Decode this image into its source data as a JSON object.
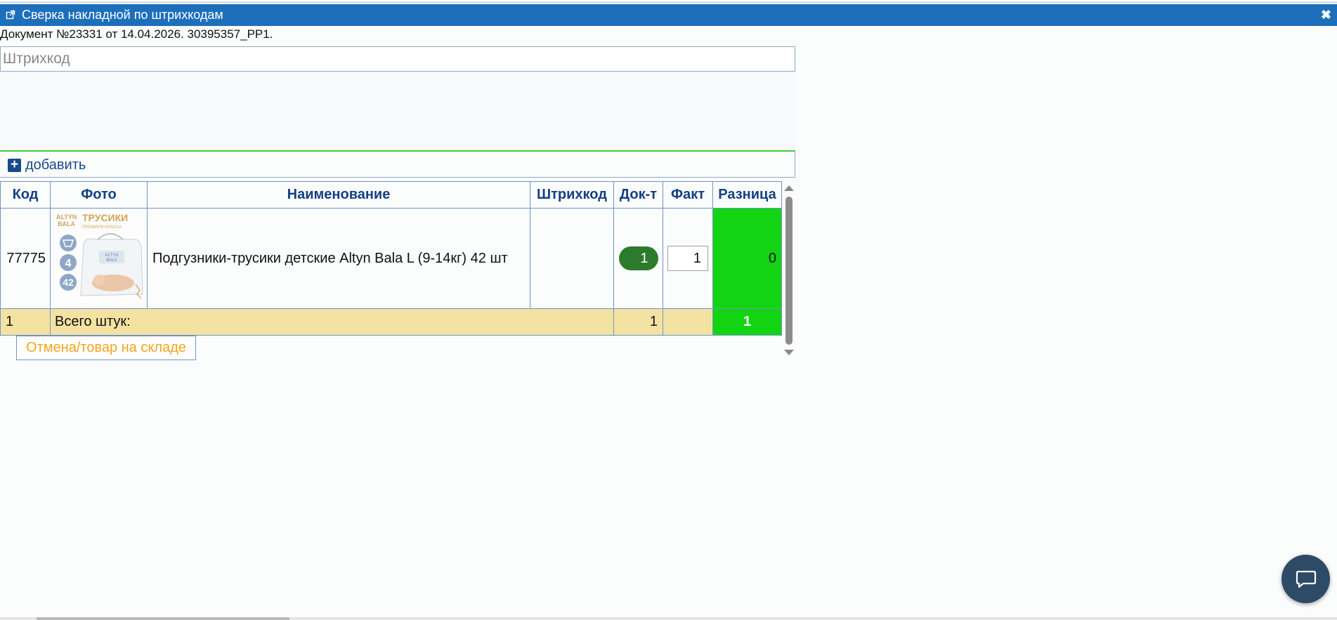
{
  "window": {
    "title": "Сверка накладной по штрихкодам",
    "external_icon": "external-link-icon",
    "close_icon": "close-icon",
    "close_glyph": "✖"
  },
  "document": {
    "info": "Документ №23331 от 14.04.2026. 30395357_РР1."
  },
  "barcode_input": {
    "placeholder": "Штрихкод",
    "value": ""
  },
  "add_button": {
    "label": "добавить",
    "icon": "plus-icon",
    "glyph": "+"
  },
  "table": {
    "columns": [
      "Код",
      "Фото",
      "Наименование",
      "Штрихкод",
      "Док-т",
      "Факт",
      "Разница"
    ],
    "rows": [
      {
        "code": "77775",
        "photo": "product-photo",
        "name": "Подгузники-трусики детские Altyn Bala L (9-14кг) 42 шт",
        "barcode": "",
        "doc_qty": "1",
        "fact_qty": "1",
        "diff": "0"
      }
    ],
    "total": {
      "count": "1",
      "label": "Всего штук:",
      "doc_total": "1",
      "diff_total": "1"
    }
  },
  "cancel_button": {
    "label": "Отмена/товар на складе"
  },
  "chat_button": {
    "icon": "chat-bubble-icon"
  },
  "colors": {
    "titlebar": "#1e6fbb",
    "header_text": "#123f83",
    "doc_pill": "#2c7b2c",
    "diff_ok": "#13d413",
    "total_row": "#f4e2a2",
    "cancel_text": "#f5a31a",
    "add_border": "#3fcc3f"
  }
}
